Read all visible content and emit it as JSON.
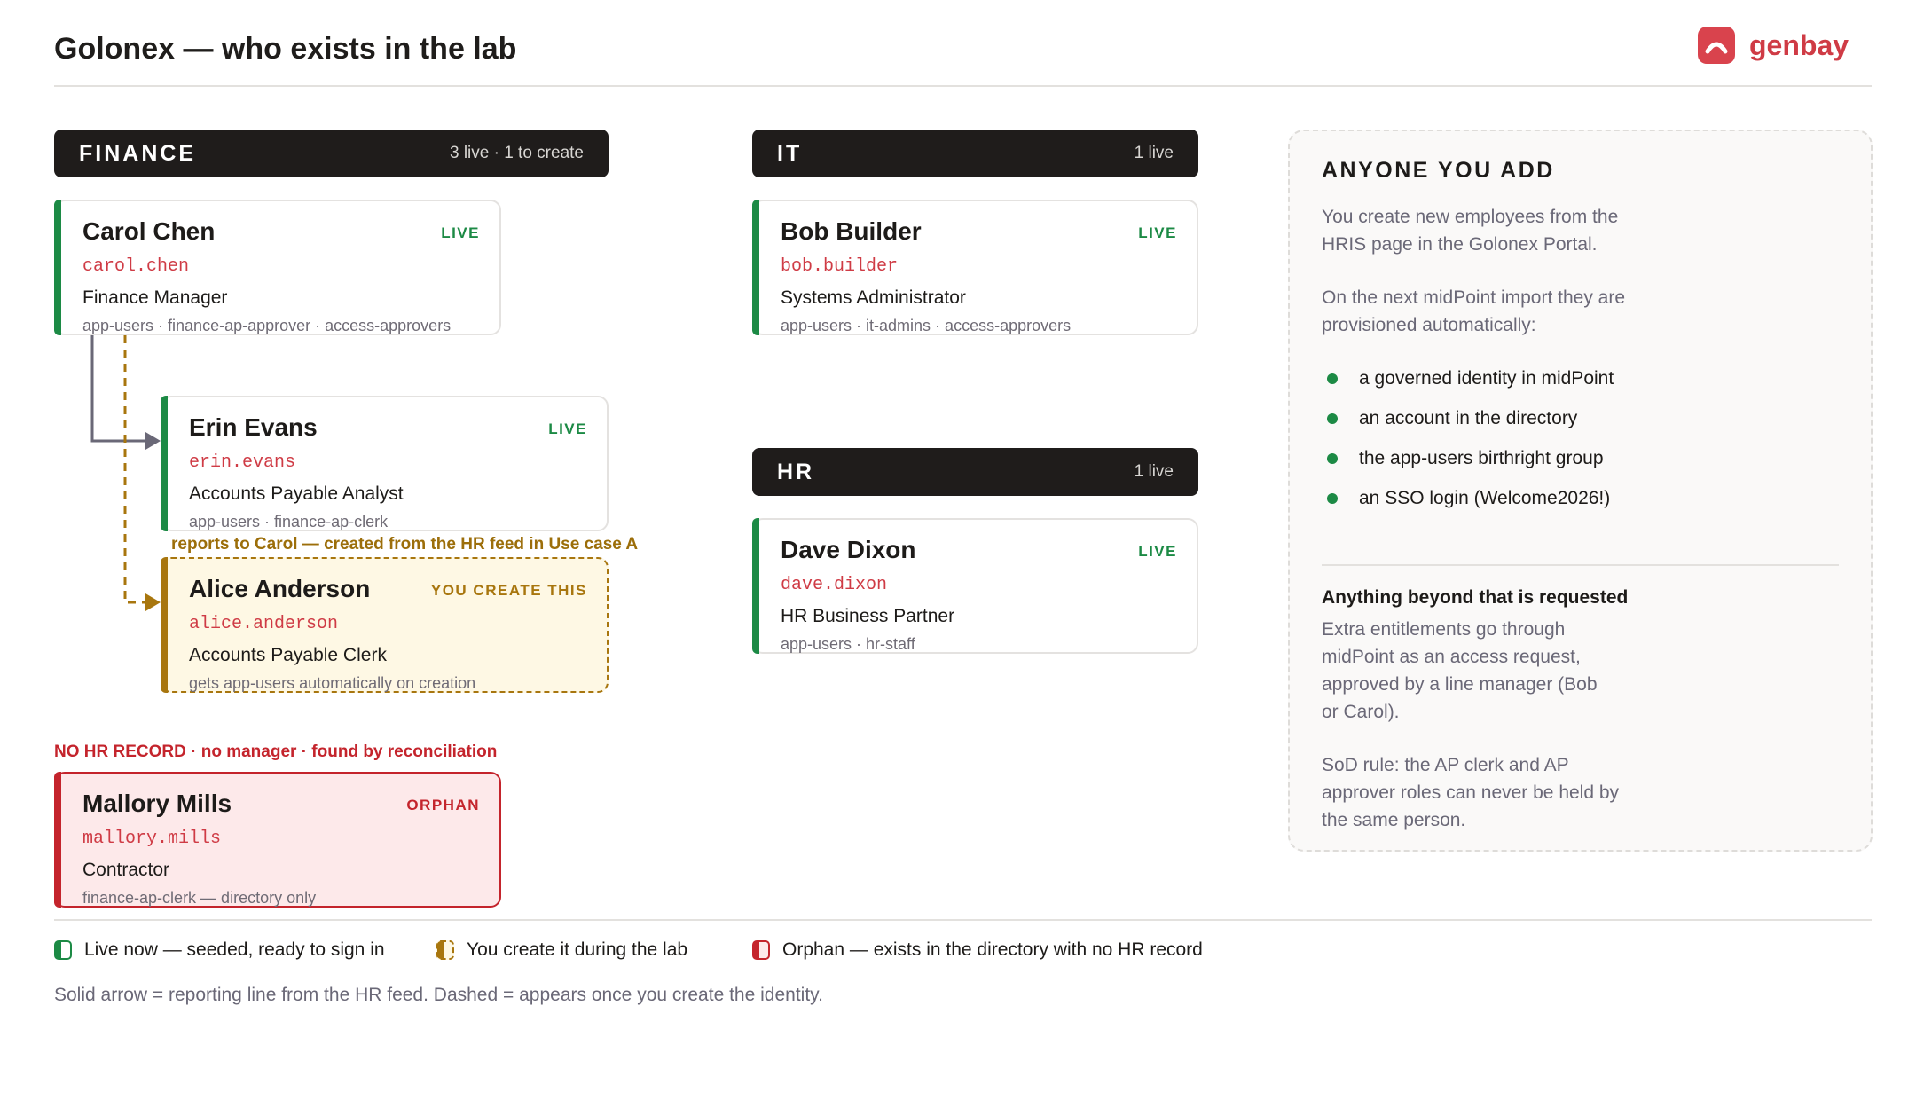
{
  "header": {
    "title": "Golonex — who exists in the lab",
    "brand": "genbay"
  },
  "departments": {
    "finance": {
      "name": "FINANCE",
      "meta": "3 live · 1 to create"
    },
    "it": {
      "name": "IT",
      "meta": "1 live"
    },
    "hr": {
      "name": "HR",
      "meta": "1 live"
    }
  },
  "people": {
    "carol": {
      "name": "Carol Chen",
      "login": "carol.chen",
      "role": "Finance Manager",
      "groups": "app-users · finance-ap-approver · access-approvers",
      "status": "LIVE"
    },
    "erin": {
      "name": "Erin Evans",
      "login": "erin.evans",
      "role": "Accounts Payable Analyst",
      "groups": "app-users · finance-ap-clerk",
      "status": "LIVE"
    },
    "alice": {
      "name": "Alice Anderson",
      "login": "alice.anderson",
      "role": "Accounts Payable Clerk",
      "groups": "gets app-users automatically on creation",
      "status": "YOU CREATE THIS"
    },
    "mallory": {
      "name": "Mallory Mills",
      "login": "mallory.mills",
      "role": "Contractor",
      "groups": "finance-ap-clerk — directory only",
      "status": "ORPHAN"
    },
    "bob": {
      "name": "Bob Builder",
      "login": "bob.builder",
      "role": "Systems Administrator",
      "groups": "app-users · it-admins · access-approvers",
      "status": "LIVE"
    },
    "dave": {
      "name": "Dave Dixon",
      "login": "dave.dixon",
      "role": "HR Business Partner",
      "groups": "app-users · hr-staff",
      "status": "LIVE"
    }
  },
  "notes": {
    "alice": "reports to Carol — created from the HR feed in Use case A",
    "mallory": "NO HR RECORD · no manager · found by reconciliation"
  },
  "sidebar": {
    "title": "ANYONE YOU ADD",
    "intro": "You create new employees from the HRIS page in the Golonex Portal.",
    "next": "On the next midPoint import they are provisioned automatically:",
    "items": [
      "a governed identity in midPoint",
      "an account in the directory",
      "the app-users birthright group",
      "an SSO login (Welcome2026!)"
    ],
    "beyond_heading": "Anything beyond that is requested",
    "beyond_text": "Extra entitlements go through midPoint as an access request, approved by a line manager (Bob or Carol).",
    "sod": "SoD rule: the AP clerk and AP approver roles can never be held by the same person."
  },
  "legend": {
    "live": "Live now — seeded, ready to sign in",
    "create": "You create it during the lab",
    "orphan": "Orphan — exists in the directory with no HR record",
    "caption": "Solid arrow = reporting line from the HR feed. Dashed = appears once you create the identity."
  },
  "colors": {
    "live": "#1c8a45",
    "create": "#a8760e",
    "orphan": "#c4242c",
    "brand": "#d9434d"
  }
}
